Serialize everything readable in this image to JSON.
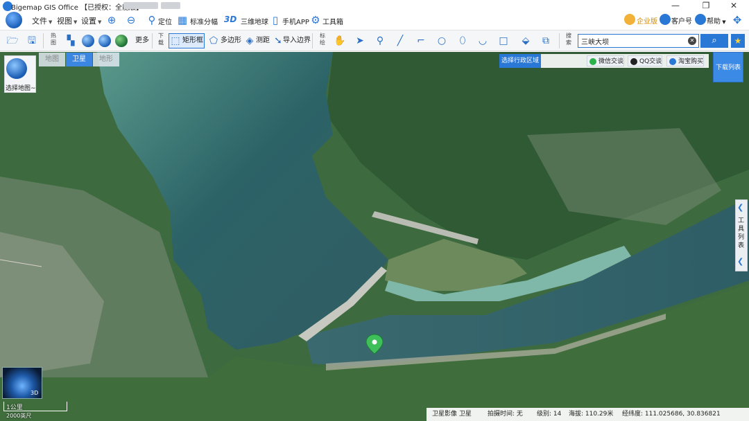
{
  "window": {
    "title": "Bigemap GIS Office 【已授权：全能版】",
    "minimize": "—",
    "restore": "❐",
    "close": "✕"
  },
  "menu": {
    "file": "文件",
    "view": "视图",
    "settings": "设置",
    "locate": "定位",
    "standard_sheet": "标准分幅",
    "three_d_icon": "3D",
    "three_d_globe": "三维地球",
    "mobile_app": "手机APP",
    "toolbox": "工具箱",
    "enterprise": "企业版",
    "customer_id": "客户号",
    "help": "帮助"
  },
  "toolbar": {
    "hotmap_label": "热图",
    "more": "更多",
    "download_label": "下载",
    "rect_box": "矩形框",
    "polygon": "多边形",
    "measure": "测距",
    "import_boundary": "导入边界",
    "annotate_label": "标绘",
    "search_label": "搜索",
    "search_value": "三峡大坝"
  },
  "map": {
    "selector_label": "选择地图~",
    "tabs": [
      "地图",
      "卫星",
      "地形"
    ],
    "active_tab": "卫星",
    "region_select": "选择行政区域",
    "share_wechat": "微信交谈",
    "share_qq": "QQ交谈",
    "share_taobao": "淘宝购买",
    "download_list": "下载列表",
    "tool_list_chars": [
      "工",
      "具",
      "列",
      "表"
    ],
    "minimap_3d": "3D",
    "scale_km": "1公里",
    "scale_ft": "2000英尺"
  },
  "status": {
    "source": "卫星影像 卫星",
    "capture_time": "拍摄时间: 无",
    "level": "级别: 14",
    "altitude": "海拔: 110.29米",
    "coords": "经纬度: 111.025686, 30.836821"
  },
  "colors": {
    "accent": "#2a78d6",
    "water": "#2f6a6a",
    "forest": "#3b6a3d"
  }
}
